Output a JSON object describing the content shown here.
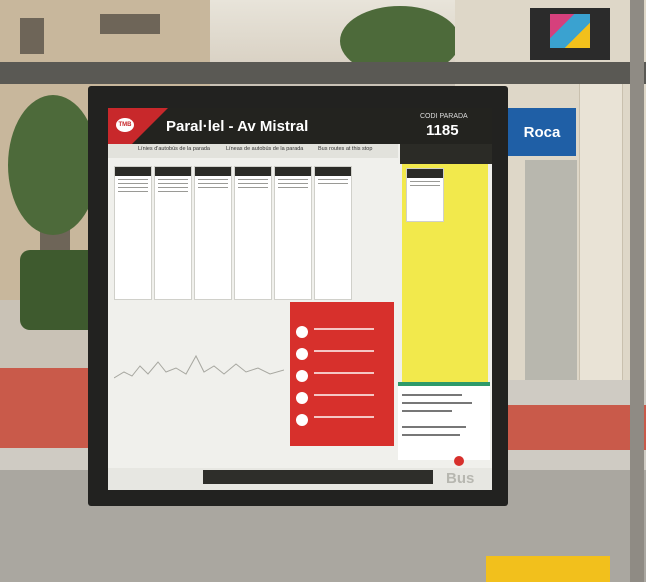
{
  "stop": {
    "name": "Paral·lel - Av Mistral",
    "code_label": "CODI PARADA",
    "code": "1185",
    "operator": "TMB"
  },
  "panel": {
    "subheaders": [
      "Línies d'autobús de la parada",
      "Líneas de autobús de la parada",
      "Bus routes at this stop"
    ],
    "footer_brand": "Bus"
  },
  "shop_sign": "Roca",
  "colors": {
    "tmb_red": "#c8282b",
    "night_yellow": "#f2e94c",
    "header_dark": "#23231f"
  }
}
